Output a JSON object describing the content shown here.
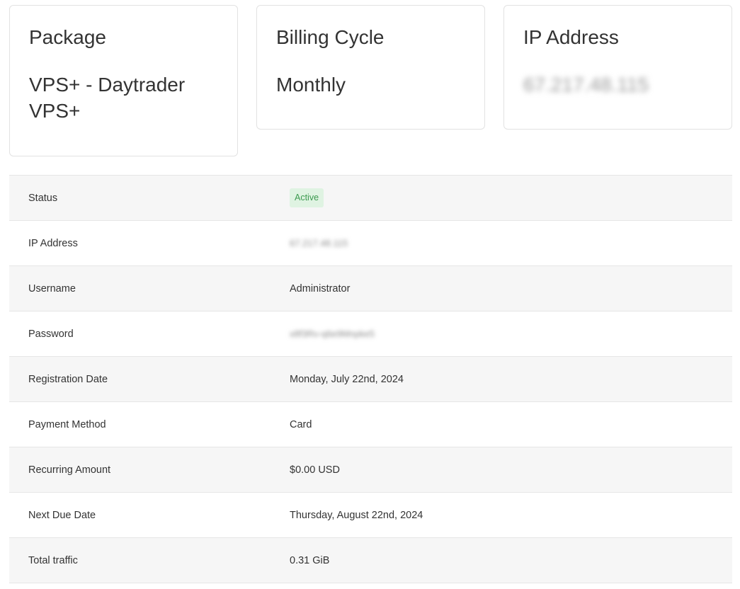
{
  "cards": {
    "package": {
      "title": "Package",
      "value": "VPS+ - Daytrader VPS+"
    },
    "billing_cycle": {
      "title": "Billing Cycle",
      "value": "Monthly"
    },
    "ip_address": {
      "title": "IP Address",
      "value": "67.217.48.115"
    }
  },
  "details": {
    "status": {
      "label": "Status",
      "value": "Active",
      "badge_color": "#3c9a4f",
      "badge_bg": "#dff3e2"
    },
    "ip_address": {
      "label": "IP Address",
      "value": "67.217.48.115"
    },
    "username": {
      "label": "Username",
      "value": "Administrator"
    },
    "password": {
      "label": "Password",
      "value": "x8f3Rv-q6e9Mnpke5"
    },
    "registration_date": {
      "label": "Registration Date",
      "value": "Monday, July 22nd, 2024"
    },
    "payment_method": {
      "label": "Payment Method",
      "value": "Card"
    },
    "recurring_amount": {
      "label": "Recurring Amount",
      "value": "$0.00 USD"
    },
    "next_due_date": {
      "label": "Next Due Date",
      "value": "Thursday, August 22nd, 2024"
    },
    "total_traffic": {
      "label": "Total traffic",
      "value": "0.31 GiB"
    }
  }
}
